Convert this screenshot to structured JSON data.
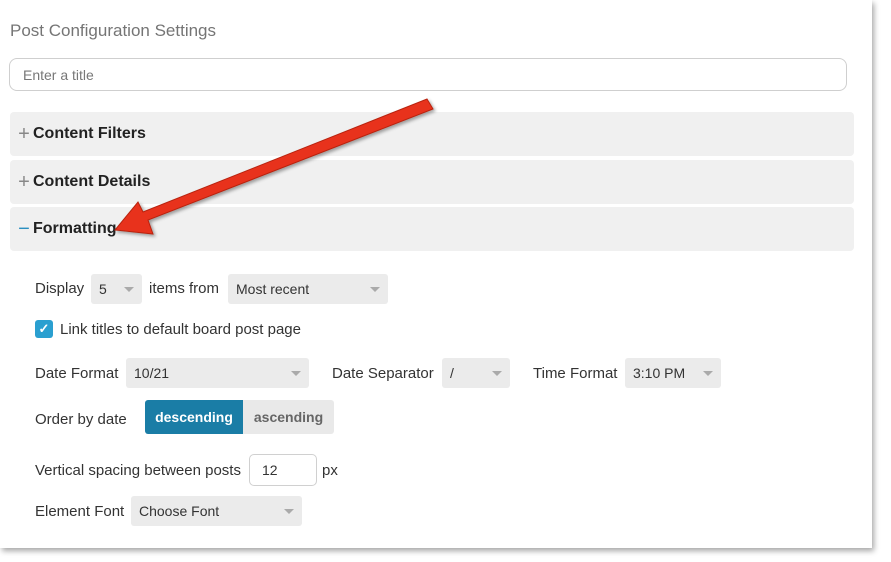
{
  "page_title": "Post Configuration Settings",
  "title_input": {
    "placeholder": "Enter a title",
    "value": ""
  },
  "sections": [
    {
      "label": "Content Filters",
      "sign": "+",
      "expanded": false
    },
    {
      "label": "Content Details",
      "sign": "+",
      "expanded": false
    },
    {
      "label": "Formatting",
      "sign": "−",
      "expanded": true
    }
  ],
  "formatting": {
    "display_label": "Display",
    "display_count": "5",
    "items_from_label": "items from",
    "items_from_value": "Most recent",
    "link_titles_label": "Link titles to default board post page",
    "link_titles_checked": true,
    "date_format_label": "Date Format",
    "date_format_value": "10/21",
    "date_separator_label": "Date Separator",
    "date_separator_value": "/",
    "time_format_label": "Time Format",
    "time_format_value": "3:10 PM",
    "order_label": "Order by date",
    "order_options": [
      "descending",
      "ascending"
    ],
    "order_selected": "descending",
    "spacing_label": "Vertical spacing between posts",
    "spacing_value": "12",
    "spacing_unit": "px",
    "font_label": "Element Font",
    "font_value": "Choose Font"
  },
  "colors": {
    "accent": "#1a7da6",
    "checkbox": "#2a9fd0",
    "annotation_arrow": "#e8321c"
  },
  "icons": {
    "expand": "plus-icon",
    "collapse": "minus-icon",
    "dropdown": "caret-down-icon",
    "check": "check-icon"
  }
}
